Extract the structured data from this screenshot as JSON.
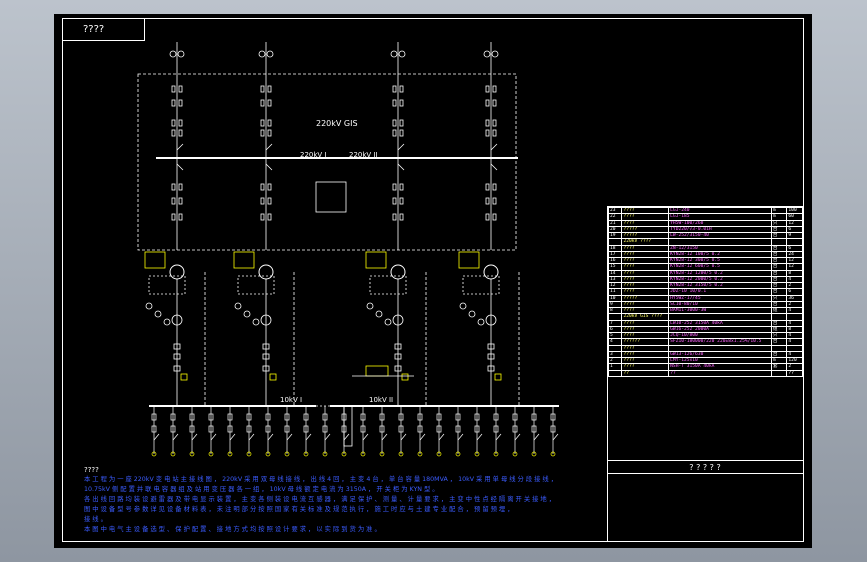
{
  "title": "????",
  "bus": {
    "gis_label": "220kV GIS",
    "bus_left_label": "220kV I",
    "bus_right_label": "220kV II",
    "lv_left_label": "10kV I",
    "lv_right_label": "10kV II"
  },
  "notes": {
    "heading": "????",
    "lines": [
      "本 工 程 为 一 座 220kV 变 电 站 主 接 线 图 ， 220kV 采 用 双 母 线 接 线 ， 出 线 4 回 ， 主 变 4 台 ， 单 台 容 量 180MVA ， 10kV 采 用 单 母 线 分 段 接 线 ，",
      "10.75kV 侧 配 置 并 联 电 容 器 组 及 站 用 变 压 器 各 一 组 ， 10kV 母 线 额 定 电 流 为 3150A ， 开 关 柜 为 KYN 型 。",
      "各 出 线 回 路 均 装 设 避 雷 器 及 带 电 显 示 装 置 ， 主 变 各 侧 装 设 电 流 互 感 器 ， 满 足 保 护 、 测 量 、 计 量 要 求 ， 主 变 中 性 点 经 隔 离 开 关 接 地 ，",
      "图 中 设 备 型 号 参 数 详 见 设 备 材 料 表 ， 未 注 明 部 分 按 照 国 家 有 关 标 准 及 规 范 执 行 ， 施 工 时 应 与 土 建 专 业 配 合 ， 预 留 预 埋 ，",
      "接 线 。",
      "本 图 中 电 气 主 设 备 选 型 、 保 护 配 置 、 接 地 方 式 均 按 照 设 计 要 求 ， 以 实 际 到 货 为 准 。"
    ]
  },
  "bom": {
    "title": "? ? ? ? ?",
    "rows": [
      [
        "23",
        "????",
        "LGJ-240",
        "m",
        "100"
      ],
      [
        "22",
        "????",
        "LGJ-185",
        "m",
        "60"
      ],
      [
        "21",
        "????",
        "YH5W-100/260",
        "只",
        "12"
      ],
      [
        "20",
        "?????",
        "TYD220/√3-0.01H",
        "台",
        "6"
      ],
      [
        "19",
        "?????",
        "LW-252/3150-40",
        "台",
        "9"
      ],
      [
        "",
        "220kV ????",
        "",
        "",
        ""
      ],
      [
        "18",
        "????",
        "ZN-12/3150",
        "台",
        "6"
      ],
      [
        "17",
        "????",
        "KYN28-12 100/5 0.2",
        "台",
        "24"
      ],
      [
        "16",
        "????",
        "KYN28-12 300/5 0.5",
        "台",
        "12"
      ],
      [
        "15",
        "????",
        "KYN28-12 600/5 0.5",
        "台",
        "12"
      ],
      [
        "14",
        "????",
        "KYN28-12 1200/5 0.2",
        "台",
        "8"
      ],
      [
        "13",
        "????",
        "KYN28-12 2000/5 0.2",
        "台",
        "4"
      ],
      [
        "12",
        "????",
        "KYN28-12 3150/5 0.2",
        "台",
        "2"
      ],
      [
        "11",
        "????",
        "JDZ-10 10/0.1",
        "台",
        "6"
      ],
      [
        "10",
        "?????",
        "HY5WZ-17/45",
        "只",
        "36"
      ],
      [
        "9",
        "????",
        "SC10-80/10",
        "台",
        "2"
      ],
      [
        "8",
        "????",
        "BAM11-3000-3W",
        "组",
        "4"
      ],
      [
        "",
        "220kV GIS ????",
        "",
        "",
        ""
      ],
      [
        "7",
        "????",
        "LW10-252 3150A 40kA",
        "台",
        "4"
      ],
      [
        "6",
        "????",
        "GW16-252 2000A",
        "组",
        "8"
      ],
      [
        "5",
        "????",
        "JCQ-10/800",
        "只",
        "4"
      ],
      [
        "4",
        "??????",
        "SFZ10-180000/220 220±8x1.25%/10.5",
        "台",
        "4"
      ],
      [
        "",
        "????",
        "",
        "",
        ""
      ],
      [
        "3",
        "????",
        "GW13-126/630",
        "台",
        "4"
      ],
      [
        "2",
        "????",
        "LMY-125x10",
        "m",
        "120"
      ],
      [
        "1",
        "????",
        "NSH-T 3150A 40kA",
        "套",
        "2"
      ],
      [
        "",
        "??",
        "??",
        "",
        "??"
      ]
    ]
  }
}
